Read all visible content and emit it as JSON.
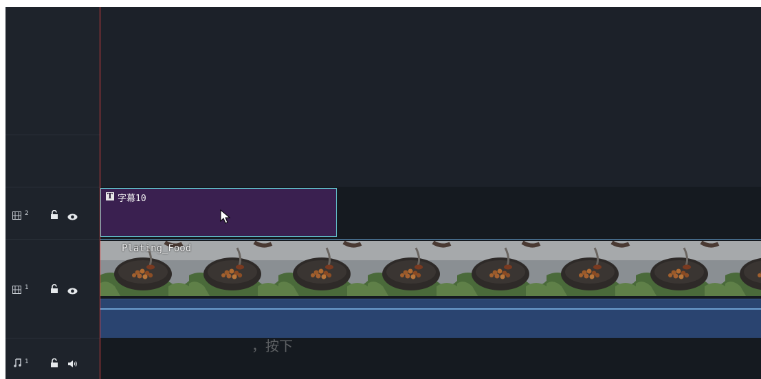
{
  "tracks": {
    "video2": {
      "number": "2",
      "icon": "film-strip-icon"
    },
    "video1": {
      "number": "1",
      "icon": "film-strip-icon"
    },
    "audio1": {
      "number": "1",
      "icon": "music-note-icon"
    }
  },
  "clips": {
    "title_clip": {
      "label": "字幕10",
      "badge": "T",
      "color": "#3a2050",
      "border": "#5fb8c4"
    },
    "video_clip": {
      "label": "Plating_Food",
      "audio_color": "#2a4470"
    }
  },
  "overlay": {
    "subtitle_text": "，按下"
  },
  "colors": {
    "playhead": "#e04040",
    "background": "#1b2028"
  }
}
